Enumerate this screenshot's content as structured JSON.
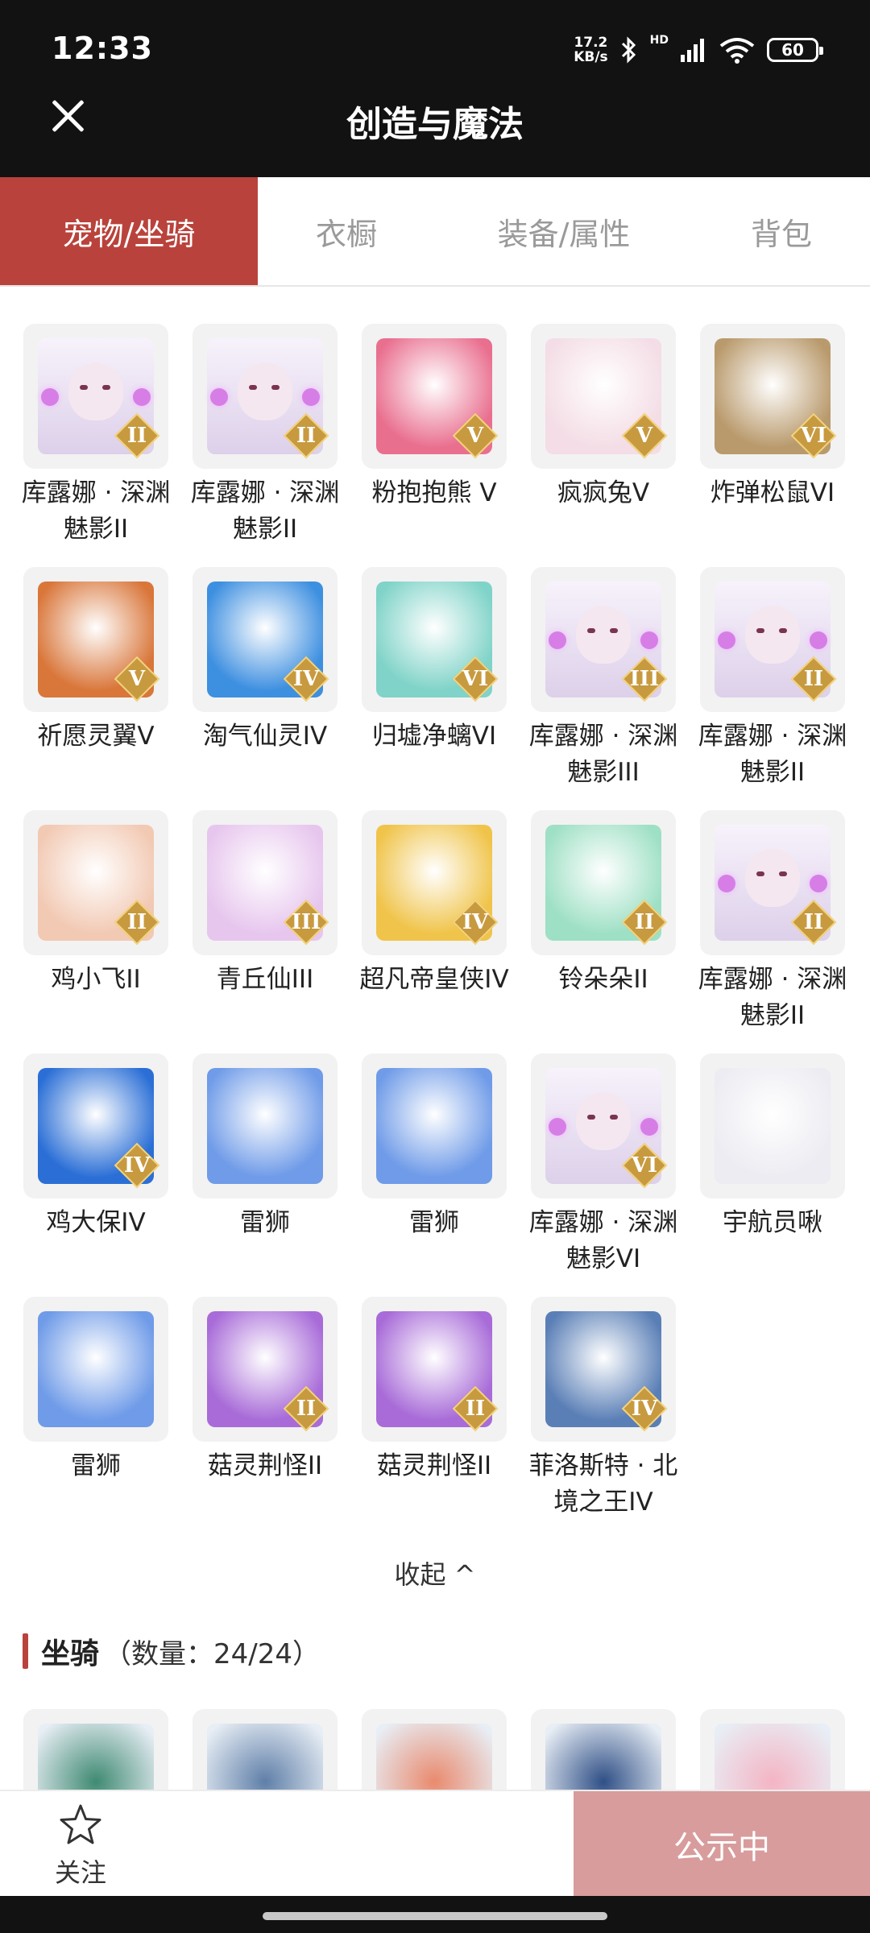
{
  "status": {
    "time": "12:33",
    "net_speed_value": "17.2",
    "net_speed_unit": "KB/s",
    "hd": "HD",
    "battery": "60"
  },
  "header": {
    "title": "创造与魔法"
  },
  "tabs": [
    {
      "label": "宠物/坐骑",
      "active": true
    },
    {
      "label": "衣橱",
      "active": false
    },
    {
      "label": "装备/属性",
      "active": false
    },
    {
      "label": "背包",
      "active": false
    }
  ],
  "pets": [
    {
      "name": "库露娜 · 深渊魅影II",
      "grade": "II",
      "icon": "silver-haired-girl-icon",
      "color": "#e9d8f0"
    },
    {
      "name": "库露娜 · 深渊魅影II",
      "grade": "II",
      "icon": "silver-haired-girl-icon",
      "color": "#e9d8f0"
    },
    {
      "name": "粉抱抱熊 V",
      "grade": "V",
      "icon": "pink-bear-icon",
      "color": "#e96f8f"
    },
    {
      "name": "疯疯兔V",
      "grade": "V",
      "icon": "rabbit-icon",
      "color": "#f4dde6"
    },
    {
      "name": "炸弹松鼠VI",
      "grade": "VI",
      "icon": "squirrel-icon",
      "color": "#b99a6c"
    },
    {
      "name": "祈愿灵翼V",
      "grade": "V",
      "icon": "griffin-icon",
      "color": "#d9763a"
    },
    {
      "name": "淘气仙灵IV",
      "grade": "IV",
      "icon": "blue-dog-icon",
      "color": "#3d8fe0"
    },
    {
      "name": "归墟净螭VI",
      "grade": "VI",
      "icon": "dragon-icon",
      "color": "#7fd3c8"
    },
    {
      "name": "库露娜 · 深渊魅影III",
      "grade": "III",
      "icon": "silver-haired-girl-icon",
      "color": "#e9d8f0"
    },
    {
      "name": "库露娜 · 深渊魅影II",
      "grade": "II",
      "icon": "silver-haired-girl-icon",
      "color": "#e9d8f0"
    },
    {
      "name": "鸡小飞II",
      "grade": "II",
      "icon": "chick-muscle-icon",
      "color": "#f2c9b3"
    },
    {
      "name": "青丘仙III",
      "grade": "III",
      "icon": "fox-girl-icon",
      "color": "#e7c6ee"
    },
    {
      "name": "超凡帝皇侠IV",
      "grade": "IV",
      "icon": "golden-knight-icon",
      "color": "#f0c44a"
    },
    {
      "name": "铃朵朵II",
      "grade": "II",
      "icon": "flower-fairy-icon",
      "color": "#9ee0c5"
    },
    {
      "name": "库露娜 · 深渊魅影II",
      "grade": "II",
      "icon": "silver-haired-girl-icon",
      "color": "#e9d8f0"
    },
    {
      "name": "鸡大保IV",
      "grade": "IV",
      "icon": "blue-bird-icon",
      "color": "#2b6fd6"
    },
    {
      "name": "雷狮",
      "grade": "",
      "icon": "thunder-lion-icon",
      "color": "#6f9be8"
    },
    {
      "name": "雷狮",
      "grade": "",
      "icon": "thunder-lion-icon",
      "color": "#6f9be8"
    },
    {
      "name": "库露娜 · 深渊魅影VI",
      "grade": "VI",
      "icon": "silver-haired-girl-icon",
      "color": "#e9d8f0"
    },
    {
      "name": "宇航员啾",
      "grade": "",
      "icon": "astronaut-cow-icon",
      "color": "#ececf2"
    },
    {
      "name": "雷狮",
      "grade": "",
      "icon": "thunder-lion-icon",
      "color": "#6f9be8"
    },
    {
      "name": "菇灵荆怪II",
      "grade": "II",
      "icon": "purple-hair-doll-icon",
      "color": "#a86bd8"
    },
    {
      "name": "菇灵荆怪II",
      "grade": "II",
      "icon": "purple-hair-doll-icon",
      "color": "#a86bd8"
    },
    {
      "name": "菲洛斯特 · 北境之王IV",
      "grade": "IV",
      "icon": "ice-dragon-icon",
      "color": "#5a7fb6"
    }
  ],
  "collapse": {
    "label": "收起 ^"
  },
  "mounts": {
    "title": "坐骑",
    "count": "（数量：24/24）",
    "items": [
      {
        "icon": "green-dragon-icon",
        "color": "#3f8a72"
      },
      {
        "icon": "dark-dragon-icon",
        "color": "#5f7fa8"
      },
      {
        "icon": "goggle-bird-icon",
        "color": "#e98a6e"
      },
      {
        "icon": "blue-dragon-icon",
        "color": "#2f4f86"
      },
      {
        "icon": "unicorn-icon",
        "color": "#f4b4c4"
      }
    ]
  },
  "bottom": {
    "follow_label": "关注",
    "status_button": "公示中"
  }
}
